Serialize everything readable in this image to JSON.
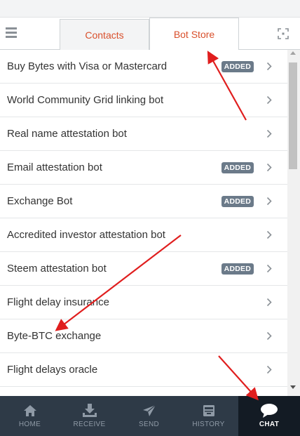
{
  "header": {
    "tabs": [
      {
        "label": "Contacts",
        "active": false
      },
      {
        "label": "Bot Store",
        "active": true
      }
    ]
  },
  "bots": [
    {
      "name": "Buy Bytes with Visa or Mastercard",
      "badge": "ADDED"
    },
    {
      "name": "World Community Grid linking bot",
      "badge": ""
    },
    {
      "name": "Real name attestation bot",
      "badge": ""
    },
    {
      "name": "Email attestation bot",
      "badge": "ADDED"
    },
    {
      "name": "Exchange Bot",
      "badge": "ADDED"
    },
    {
      "name": "Accredited investor attestation bot",
      "badge": ""
    },
    {
      "name": "Steem attestation bot",
      "badge": "ADDED"
    },
    {
      "name": "Flight delay insurance",
      "badge": ""
    },
    {
      "name": "Byte-BTC exchange",
      "badge": ""
    },
    {
      "name": "Flight delays oracle",
      "badge": ""
    }
  ],
  "bottom_nav": [
    {
      "label": "HOME",
      "icon": "home-icon",
      "active": false
    },
    {
      "label": "RECEIVE",
      "icon": "receive-icon",
      "active": false
    },
    {
      "label": "SEND",
      "icon": "send-icon",
      "active": false
    },
    {
      "label": "HISTORY",
      "icon": "history-icon",
      "active": false
    },
    {
      "label": "CHAT",
      "icon": "chat-icon",
      "active": true
    }
  ],
  "colors": {
    "accent": "#d9502c",
    "badge": "#6b7a89",
    "nav_background": "#2e3a47",
    "nav_active": "#131b24",
    "annotation_arrow": "#e01e1e"
  }
}
